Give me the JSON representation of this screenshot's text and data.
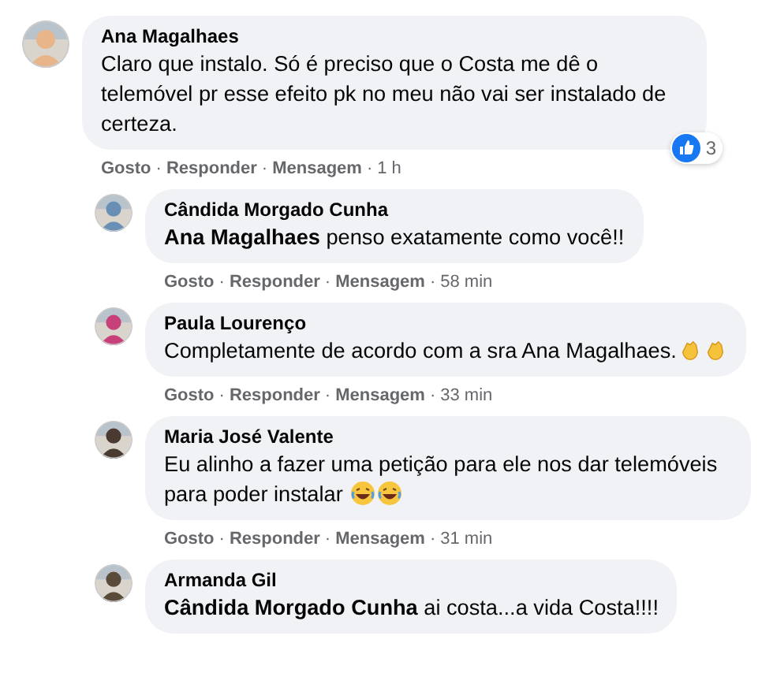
{
  "comments": [
    {
      "author": "Ana Magalhaes",
      "text": "Claro que instalo. Só é preciso que o Costa me dê o telemóvel pr esse efeito pk no meu não vai ser instalado de certeza.",
      "reactions": {
        "count": "3"
      },
      "meta": [
        {
          "kind": "link",
          "text": "Gosto"
        },
        {
          "kind": "sep",
          "text": "·"
        },
        {
          "kind": "link",
          "text": "Responder"
        },
        {
          "kind": "sep",
          "text": "·"
        },
        {
          "kind": "link",
          "text": "Mensagem"
        },
        {
          "kind": "sep",
          "text": "·"
        },
        {
          "kind": "time",
          "text": "1 h"
        }
      ],
      "replies": [
        {
          "author": "Cândida Morgado Cunha",
          "text": "**Ana Magalhaes** penso exatamente como você!!",
          "meta": [
            {
              "kind": "link",
              "text": "Gosto"
            },
            {
              "kind": "sep",
              "text": "·"
            },
            {
              "kind": "link",
              "text": "Responder"
            },
            {
              "kind": "sep",
              "text": "·"
            },
            {
              "kind": "link",
              "text": "Mensagem"
            },
            {
              "kind": "sep",
              "text": "·"
            },
            {
              "kind": "time",
              "text": "58 min"
            }
          ]
        },
        {
          "author": "Paula Lourenço",
          "text": "Completamente de acordo com a sra Ana Magalhaes.",
          "emoji": [
            {
              "kind": "clap"
            },
            {
              "kind": "clap"
            }
          ],
          "meta": [
            {
              "kind": "link",
              "text": "Gosto"
            },
            {
              "kind": "sep",
              "text": "·"
            },
            {
              "kind": "link",
              "text": "Responder"
            },
            {
              "kind": "sep",
              "text": "·"
            },
            {
              "kind": "link",
              "text": "Mensagem"
            },
            {
              "kind": "sep",
              "text": "·"
            },
            {
              "kind": "time",
              "text": "33 min"
            }
          ]
        },
        {
          "author": "Maria José Valente",
          "text": "Eu alinho a fazer uma petição para ele nos dar telemóveis para poder instalar ",
          "emoji": [
            {
              "kind": "laugh"
            },
            {
              "kind": "laugh"
            }
          ],
          "meta": [
            {
              "kind": "link",
              "text": "Gosto"
            },
            {
              "kind": "sep",
              "text": "·"
            },
            {
              "kind": "link",
              "text": "Responder"
            },
            {
              "kind": "sep",
              "text": "·"
            },
            {
              "kind": "link",
              "text": "Mensagem"
            },
            {
              "kind": "sep",
              "text": "·"
            },
            {
              "kind": "time",
              "text": "31 min"
            }
          ]
        },
        {
          "author": "Armanda Gil",
          "text": "**Cândida Morgado Cunha** ai costa...a vida Costa!!!!"
        }
      ]
    }
  ]
}
